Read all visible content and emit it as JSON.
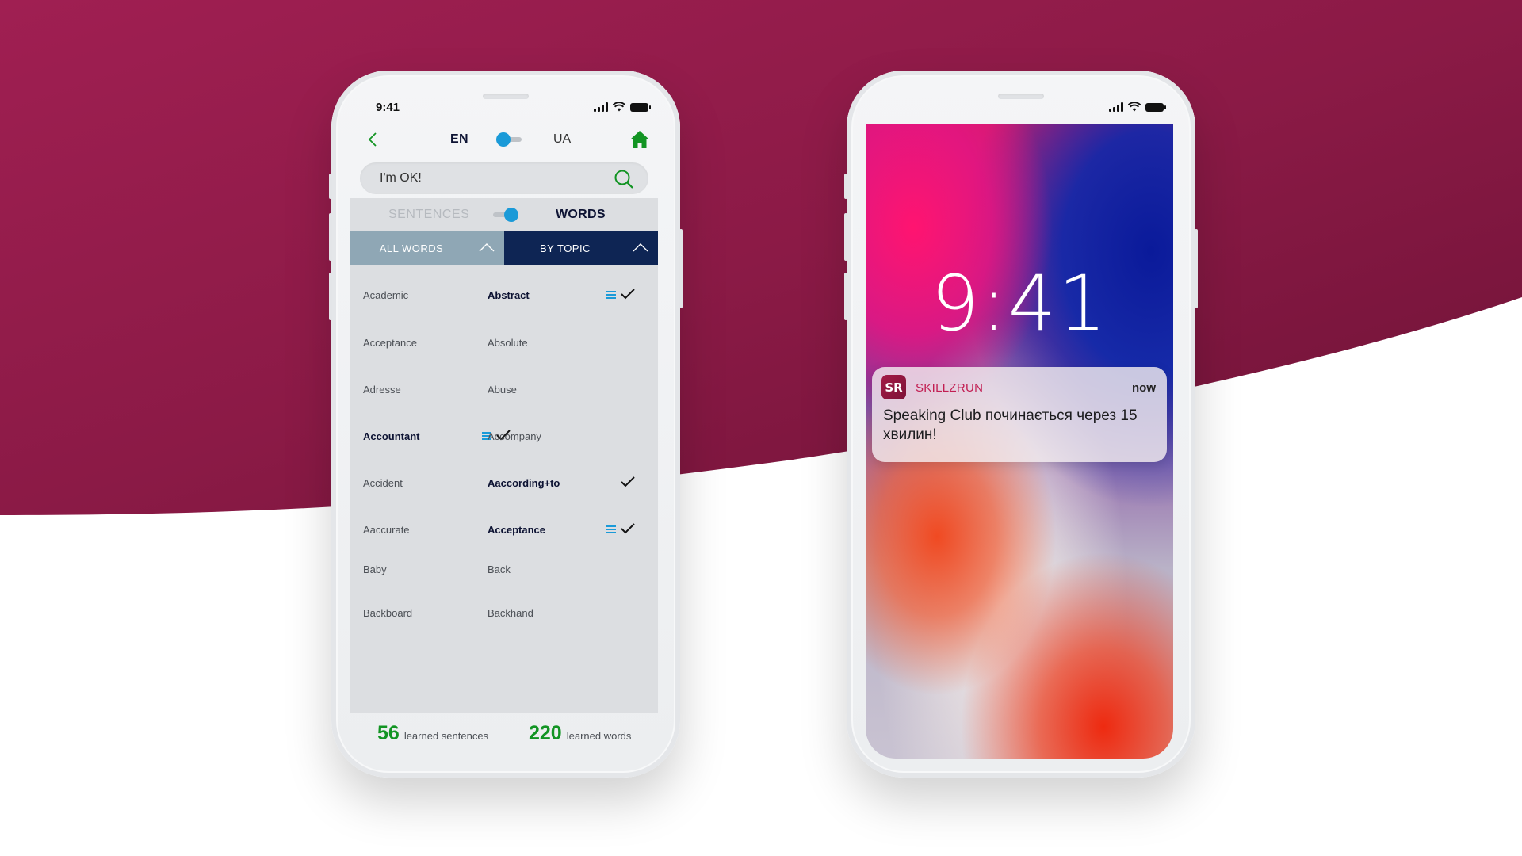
{
  "colors": {
    "brand_crimson": "#8e1a48",
    "accent_green": "#129423",
    "accent_blue": "#1a9ad8",
    "tab_active_navy": "#0e2554",
    "tab_inactive_steel": "#8fa7b5",
    "skillzrun_red": "#c21e52"
  },
  "left_phone": {
    "status_bar": {
      "time": "9:41",
      "icons": [
        "signal-icon",
        "wifi-icon",
        "battery-icon"
      ]
    },
    "nav": {
      "back_icon": "chevron-left-icon",
      "lang_from": "EN",
      "lang_to": "UA",
      "lang_toggle_state": "EN",
      "home_icon": "home-icon"
    },
    "search": {
      "value": "I'm OK!",
      "icon": "search-icon"
    },
    "mode": {
      "left_label": "SENTENCES",
      "right_label": "WORDS",
      "selected": "WORDS"
    },
    "tabs": [
      {
        "label": "ALL WORDS",
        "active": false,
        "icon": "chevron-up-icon"
      },
      {
        "label": "BY TOPIC",
        "active": true,
        "icon": "chevron-up-icon"
      }
    ],
    "words": {
      "left": [
        {
          "word": "Academic",
          "bold": false,
          "lines": false,
          "check": false
        },
        {
          "word": "Acceptance",
          "bold": false,
          "lines": false,
          "check": false
        },
        {
          "word": "Adresse",
          "bold": false,
          "lines": false,
          "check": false
        },
        {
          "word": "Accountant",
          "bold": true,
          "lines": true,
          "check": true
        },
        {
          "word": "Accident",
          "bold": false,
          "lines": false,
          "check": false
        },
        {
          "word": "Aaccurate",
          "bold": false,
          "lines": false,
          "check": false
        },
        {
          "word": "Baby",
          "bold": false,
          "lines": false,
          "check": false
        },
        {
          "word": "Backboard",
          "bold": false,
          "lines": false,
          "check": false
        }
      ],
      "right": [
        {
          "word": "Abstract",
          "bold": true,
          "lines": true,
          "check": true
        },
        {
          "word": "Absolute",
          "bold": false,
          "lines": false,
          "check": false
        },
        {
          "word": "Abuse",
          "bold": false,
          "lines": false,
          "check": false
        },
        {
          "word": "Accompany",
          "bold": false,
          "lines": false,
          "check": false
        },
        {
          "word": "Aaccording+to",
          "bold": true,
          "lines": false,
          "check": true
        },
        {
          "word": "Acceptance",
          "bold": true,
          "lines": true,
          "check": true
        },
        {
          "word": "Back",
          "bold": false,
          "lines": false,
          "check": false
        },
        {
          "word": "Backhand",
          "bold": false,
          "lines": false,
          "check": false
        }
      ]
    },
    "stats": [
      {
        "number": "56",
        "label": "learned sentences"
      },
      {
        "number": "220",
        "label": "learned words"
      }
    ]
  },
  "right_phone": {
    "status_bar": {
      "icons": [
        "signal-icon",
        "wifi-icon",
        "battery-icon"
      ]
    },
    "lock_time": "9:41",
    "notification": {
      "app_icon_text": "SR",
      "app_name": "SKILLZRUN",
      "time": "now",
      "message": "Speaking Club починається через 15 хвилин!"
    }
  }
}
